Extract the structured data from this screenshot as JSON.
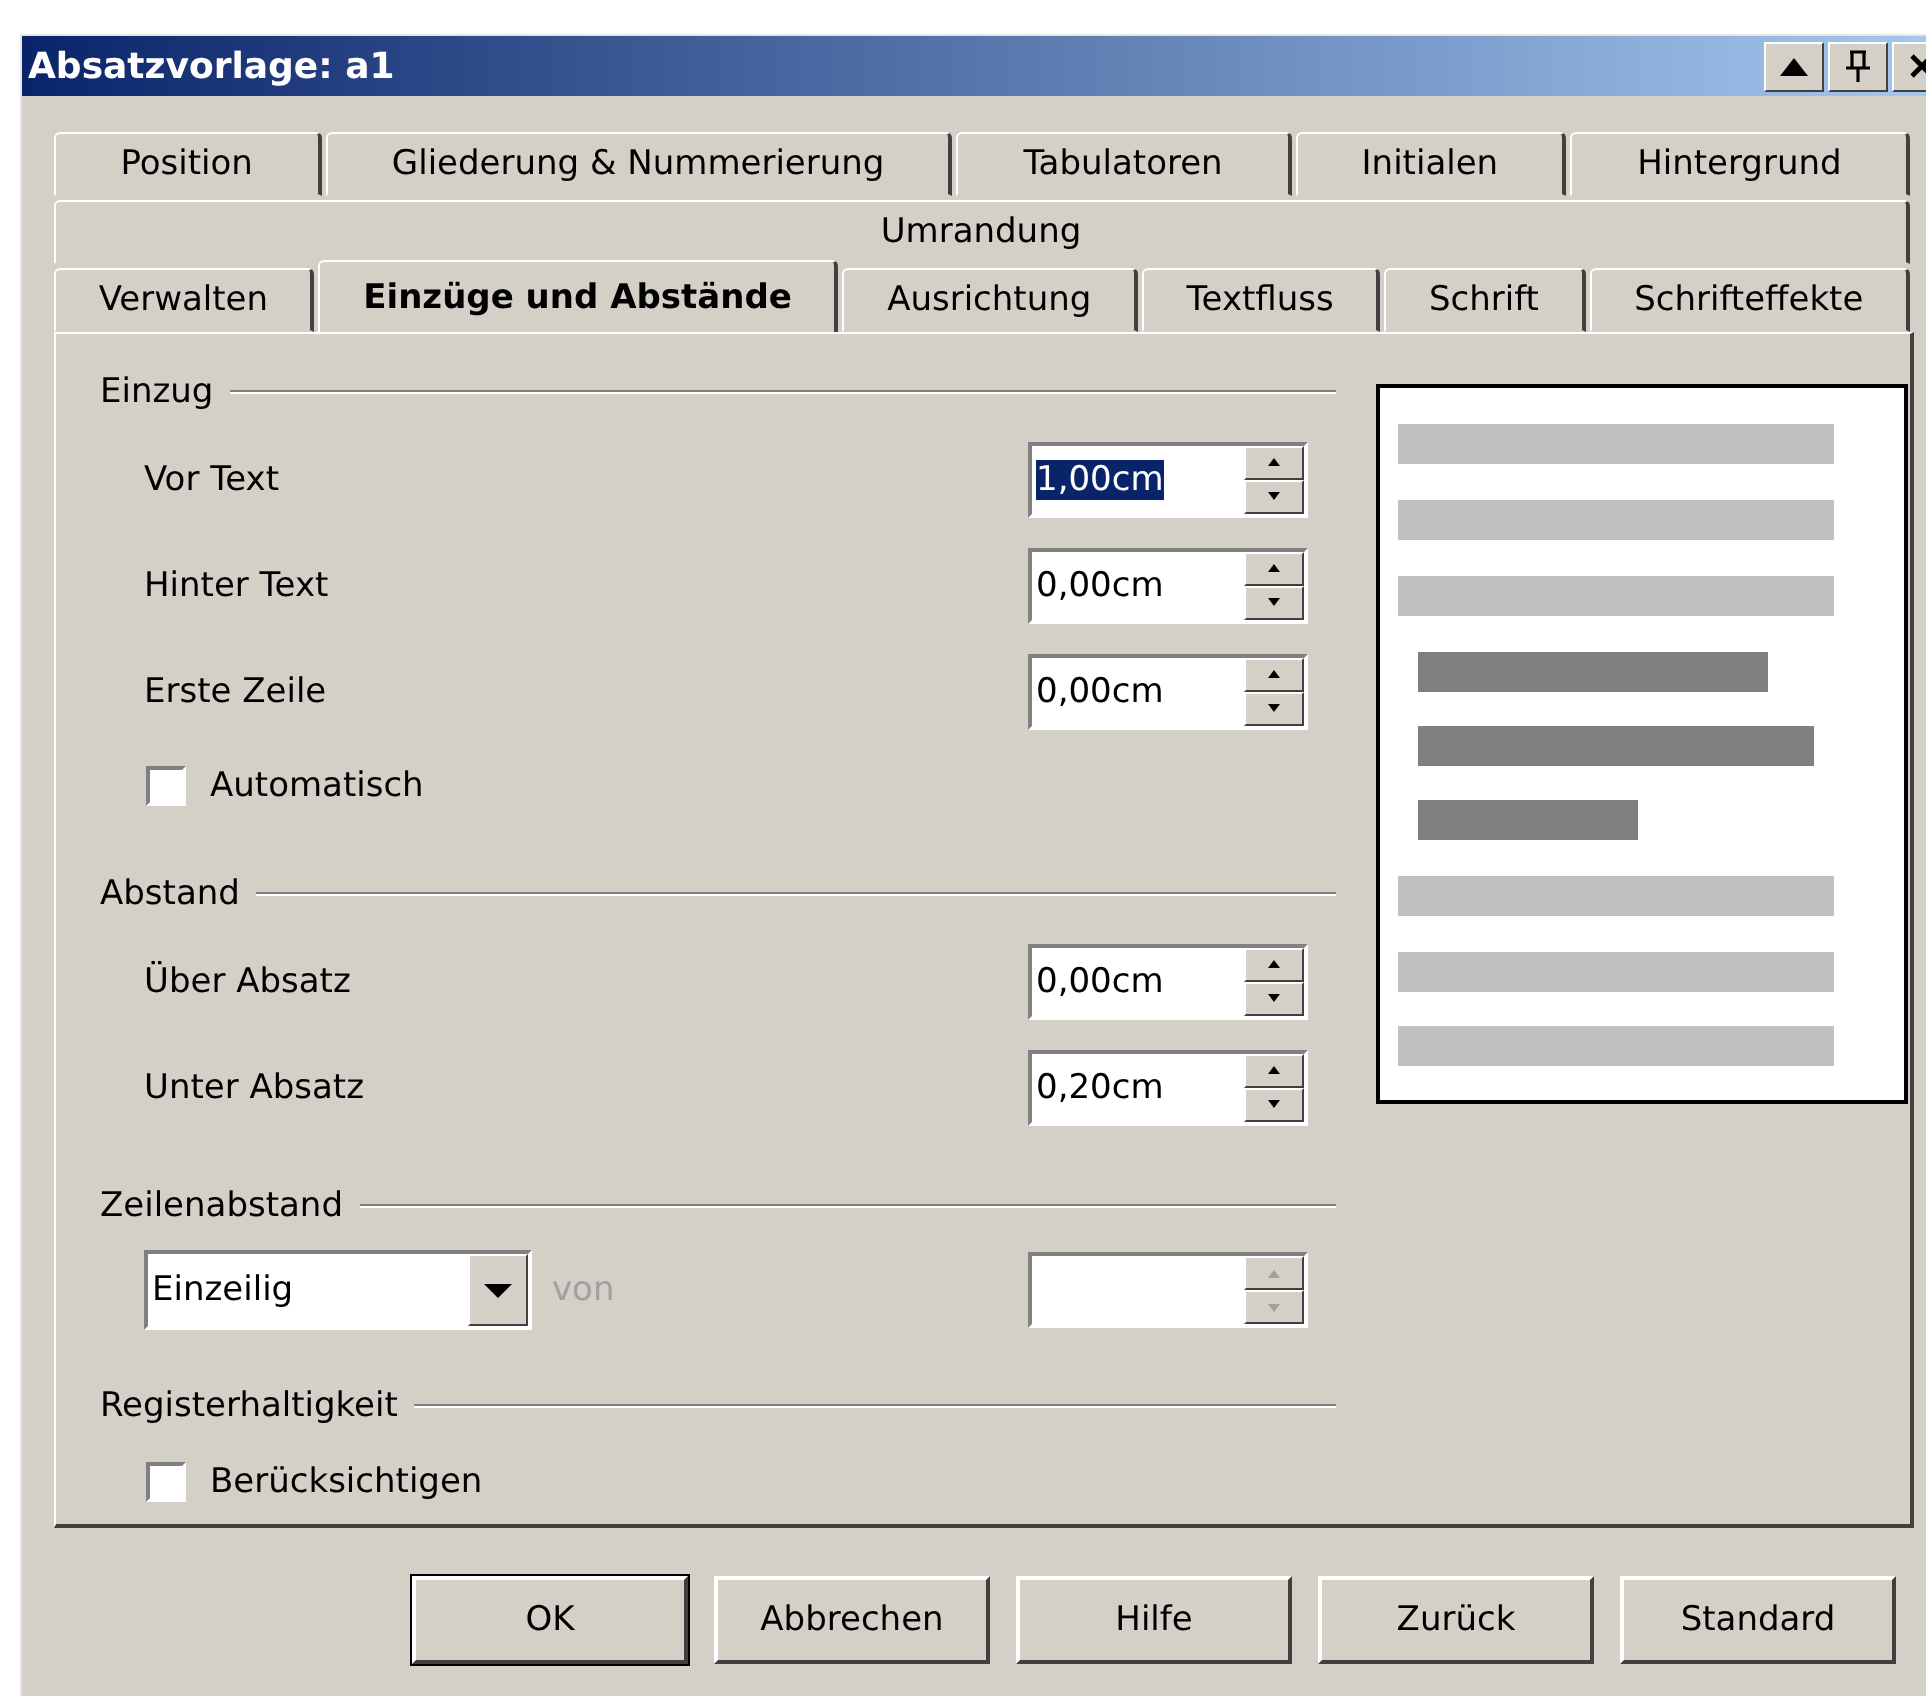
{
  "window": {
    "title": "Absatzvorlage: a1"
  },
  "tab_rows": [
    [
      {
        "label": "Position",
        "selected": false
      },
      {
        "label": "Gliederung & Nummerierung",
        "selected": false
      },
      {
        "label": "Tabulatoren",
        "selected": false
      },
      {
        "label": "Initialen",
        "selected": false
      },
      {
        "label": "Hintergrund",
        "selected": false
      }
    ],
    [
      {
        "label": "Umrandung",
        "selected": false
      }
    ],
    [
      {
        "label": "Verwalten",
        "selected": false
      },
      {
        "label": "Einzüge und Abstände",
        "selected": true
      },
      {
        "label": "Ausrichtung",
        "selected": false
      },
      {
        "label": "Textfluss",
        "selected": false
      },
      {
        "label": "Schrift",
        "selected": false
      },
      {
        "label": "Schrifteffekte",
        "selected": false
      }
    ]
  ],
  "sections": [
    {
      "title": "Einzug",
      "rows": [
        {
          "kind": "spin",
          "label": "Vor Text",
          "value": "1,00cm",
          "selected": true
        },
        {
          "kind": "spin",
          "label": "Hinter Text",
          "value": "0,00cm",
          "selected": false
        },
        {
          "kind": "spin",
          "label": "Erste Zeile",
          "value": "0,00cm",
          "selected": false
        },
        {
          "kind": "checkbox",
          "label": "Automatisch",
          "checked": false
        }
      ]
    },
    {
      "title": "Abstand",
      "rows": [
        {
          "kind": "spin",
          "label": "Über Absatz",
          "value": "0,00cm",
          "selected": false
        },
        {
          "kind": "spin",
          "label": "Unter Absatz",
          "value": "0,20cm",
          "selected": false
        }
      ]
    },
    {
      "title": "Zeilenabstand",
      "rows": [
        {
          "kind": "combo",
          "value": "Einzeilig",
          "label": "von",
          "disabled": true
        }
      ]
    },
    {
      "title": "Registerhaltigkeit",
      "rows": [
        {
          "kind": "checkbox",
          "label": "Berücksichtigen",
          "checked": false
        }
      ]
    }
  ],
  "buttons": [
    {
      "label": "OK",
      "default": true
    },
    {
      "label": "Abbrechen",
      "default": false
    },
    {
      "label": "Hilfe",
      "default": false
    },
    {
      "label": "Zurück",
      "default": false
    },
    {
      "label": "Standard",
      "default": false
    }
  ]
}
